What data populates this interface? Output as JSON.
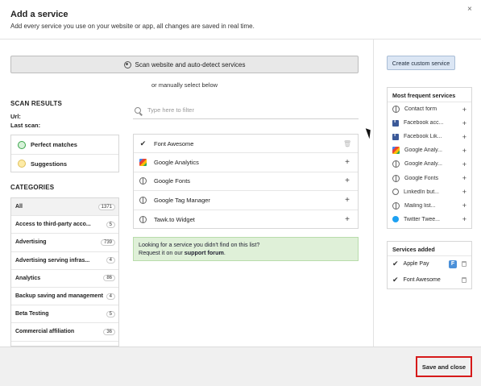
{
  "header": {
    "title": "Add a service",
    "subtitle": "Add every service you use on your website or app, all changes are saved in real time.",
    "close_label": "×"
  },
  "scan": {
    "button_label": "Scan website and auto-detect services",
    "or_manual": "or manually select below"
  },
  "scan_results": {
    "heading": "SCAN RESULTS",
    "url_label": "Url:",
    "last_scan_label": "Last scan:",
    "items": [
      {
        "label": "Perfect matches"
      },
      {
        "label": "Suggestions"
      }
    ]
  },
  "categories": {
    "heading": "CATEGORIES",
    "items": [
      {
        "label": "All",
        "count": "1371"
      },
      {
        "label": "Access to third-party acco...",
        "count": "5"
      },
      {
        "label": "Advertising",
        "count": "739"
      },
      {
        "label": "Advertising serving infras...",
        "count": "4"
      },
      {
        "label": "Analytics",
        "count": "86"
      },
      {
        "label": "Backup saving and management",
        "count": "4"
      },
      {
        "label": "Beta Testing",
        "count": "5"
      },
      {
        "label": "Commercial affiliation",
        "count": "36"
      }
    ]
  },
  "filter": {
    "placeholder": "Type here to filter"
  },
  "services": [
    {
      "name": "Font Awesome",
      "icon": "check-icon",
      "action": "trash"
    },
    {
      "name": "Google Analytics",
      "icon": "google-analytics-icon",
      "action": "+"
    },
    {
      "name": "Google Fonts",
      "icon": "globe-icon",
      "action": "+"
    },
    {
      "name": "Google Tag Manager",
      "icon": "globe-icon",
      "action": "+"
    },
    {
      "name": "Tawk.to Widget",
      "icon": "globe-icon",
      "action": "+"
    }
  ],
  "notice": {
    "line1": "Looking for a service you didn't find on this list?",
    "line2_prefix": "Request it on our ",
    "link": "support forum",
    "line2_suffix": "."
  },
  "right": {
    "custom_button": "Create custom service",
    "frequent_heading": "Most frequent services",
    "frequent": [
      {
        "name": "Contact form",
        "icon": "globe-icon"
      },
      {
        "name": "Facebook acc...",
        "icon": "facebook-icon"
      },
      {
        "name": "Facebook Lik...",
        "icon": "facebook-icon"
      },
      {
        "name": "Google Analy...",
        "icon": "google-analytics-icon"
      },
      {
        "name": "Google Analy...",
        "icon": "globe-icon"
      },
      {
        "name": "Google Fonts",
        "icon": "globe-icon"
      },
      {
        "name": "LinkedIn but...",
        "icon": "globe-icon"
      },
      {
        "name": "Mailing list...",
        "icon": "globe-icon"
      },
      {
        "name": "Twitter Twee...",
        "icon": "twitter-icon"
      }
    ],
    "plus": "+",
    "added_heading": "Services added",
    "added": [
      {
        "name": "Apple Pay",
        "badge": "F"
      },
      {
        "name": "Font Awesome",
        "badge": ""
      }
    ]
  },
  "footer": {
    "save_label": "Save and close"
  },
  "colors": {
    "notice_bg": "#dff0d8",
    "custom_btn_bg": "#dbe6f4",
    "highlight_border": "#d61a1a",
    "badge_blue": "#4a90d9"
  }
}
